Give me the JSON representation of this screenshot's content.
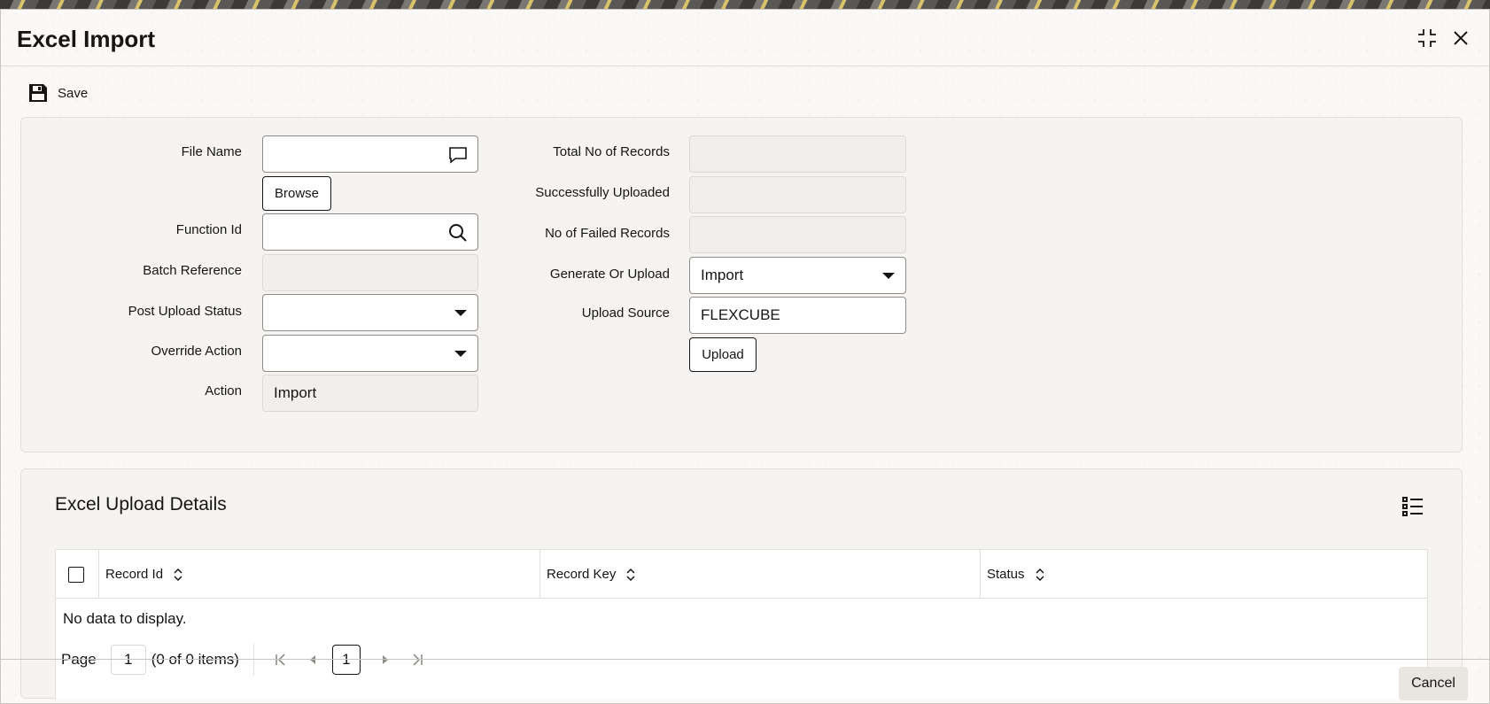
{
  "window": {
    "title": "Excel Import"
  },
  "toolbar": {
    "save_label": "Save"
  },
  "form": {
    "file_name": {
      "label": "File Name",
      "value": ""
    },
    "browse_label": "Browse",
    "function_id": {
      "label": "Function Id",
      "value": ""
    },
    "batch_reference": {
      "label": "Batch Reference",
      "value": ""
    },
    "post_upload_status": {
      "label": "Post Upload Status",
      "value": ""
    },
    "override_action": {
      "label": "Override Action",
      "value": ""
    },
    "action": {
      "label": "Action",
      "value": "Import"
    },
    "total_records": {
      "label": "Total No of Records",
      "value": ""
    },
    "successfully_uploaded": {
      "label": "Successfully Uploaded",
      "value": ""
    },
    "failed_records": {
      "label": "No of Failed Records",
      "value": ""
    },
    "generate_or_upload": {
      "label": "Generate Or Upload",
      "value": "Import"
    },
    "upload_source": {
      "label": "Upload Source",
      "value": "FLEXCUBE"
    },
    "upload_label": "Upload"
  },
  "details": {
    "title": "Excel Upload Details",
    "columns": [
      "Record Id",
      "Record Key",
      "Status"
    ],
    "empty_text": "No data to display.",
    "pager": {
      "page_label": "Page",
      "page_value": "1",
      "items_text": "(0 of 0 items)",
      "current_page": "1"
    }
  },
  "footer": {
    "cancel_label": "Cancel"
  },
  "colors": {
    "text": "#161513",
    "panel_bg": "#f5f4f2",
    "readonly_bg": "#f1efed",
    "border": "#8f8b86"
  }
}
